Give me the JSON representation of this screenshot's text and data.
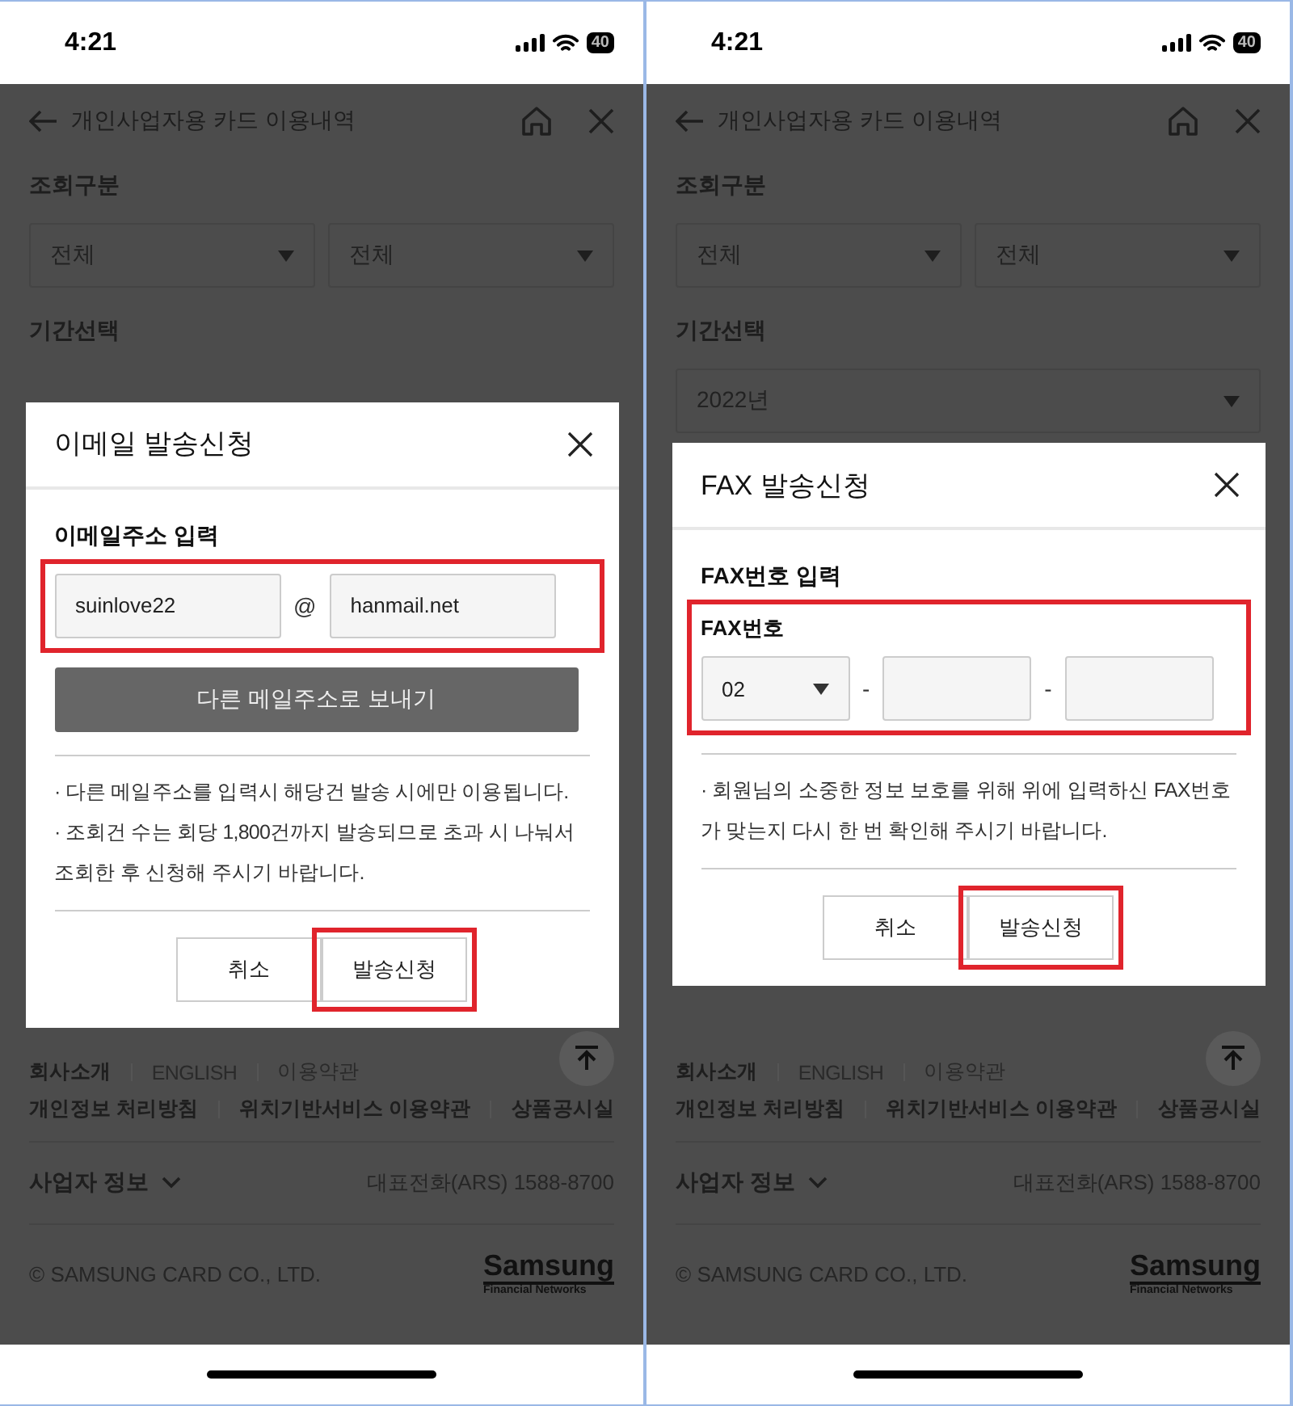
{
  "screens": [
    {
      "status_bar": {
        "time": "4:21",
        "battery": "40"
      },
      "header": {
        "title": "개인사업자용 카드 이용내역"
      },
      "form": [
        {
          "label": "조회구분",
          "selects": [
            {
              "value": "전체"
            },
            {
              "value": "전체"
            }
          ]
        },
        {
          "label": "기간선택"
        }
      ],
      "modal": {
        "title": "이메일 발송신청",
        "section_title": "이메일주소 입력",
        "field_group": {
          "highlighted": true,
          "separator": "@",
          "fields": [
            {
              "kind": "input",
              "value": "suinlove22"
            },
            {
              "kind": "input",
              "value": "hanmail.net"
            }
          ]
        },
        "wide_button": "다른 메일주소로 보내기",
        "notes": [
          "· 다른 메일주소를 입력시 해당건 발송 시에만 이용됩니다.",
          "· 조회건 수는 회당 1,800건까지 발송되므로 초과 시 나눠서 조회한 후 신청해 주시기 바랍니다."
        ],
        "buttons": [
          {
            "label": "취소",
            "highlighted": false
          },
          {
            "label": "발송신청",
            "highlighted": true
          }
        ]
      },
      "footer": {
        "links": [
          [
            {
              "label": "회사소개",
              "emphasis": true
            },
            {
              "label": "ENGLISH",
              "emphasis": false
            },
            {
              "label": "이용약관",
              "emphasis": false
            }
          ],
          [
            {
              "label": "개인정보 처리방침",
              "emphasis": true
            },
            {
              "label": "위치기반서비스 이용약관",
              "emphasis": true
            },
            {
              "label": "상품공시실",
              "emphasis": true
            }
          ]
        ],
        "business_info": "사업자 정보",
        "phone": "대표전화(ARS) 1588-8700",
        "copyright": "© SAMSUNG CARD CO., LTD.",
        "logo": {
          "name": "Samsung",
          "tagline": "Financial Networks"
        }
      }
    },
    {
      "status_bar": {
        "time": "4:21",
        "battery": "40"
      },
      "header": {
        "title": "개인사업자용 카드 이용내역"
      },
      "form": [
        {
          "label": "조회구분",
          "selects": [
            {
              "value": "전체"
            },
            {
              "value": "전체"
            }
          ]
        },
        {
          "label": "기간선택",
          "selects": [
            {
              "value": "2022년"
            }
          ]
        }
      ],
      "modal": {
        "title": "FAX 발송신청",
        "section_title": "FAX번호 입력",
        "field_group": {
          "highlighted": true,
          "label": "FAX번호",
          "separator": "-",
          "fields": [
            {
              "kind": "select",
              "value": "02"
            },
            {
              "kind": "input"
            },
            {
              "kind": "input"
            }
          ]
        },
        "notes": [
          "· 회원님의 소중한 정보 보호를 위해 위에 입력하신 FAX번호가 맞는지 다시 한 번 확인해 주시기 바랍니다."
        ],
        "buttons": [
          {
            "label": "취소",
            "highlighted": false
          },
          {
            "label": "발송신청",
            "highlighted": true
          }
        ]
      },
      "footer": {
        "links": [
          [
            {
              "label": "회사소개",
              "emphasis": true
            },
            {
              "label": "ENGLISH",
              "emphasis": false
            },
            {
              "label": "이용약관",
              "emphasis": false
            }
          ],
          [
            {
              "label": "개인정보 처리방침",
              "emphasis": true
            },
            {
              "label": "위치기반서비스 이용약관",
              "emphasis": true
            },
            {
              "label": "상품공시실",
              "emphasis": true
            }
          ]
        ],
        "business_info": "사업자 정보",
        "phone": "대표전화(ARS) 1588-8700",
        "copyright": "© SAMSUNG CARD CO., LTD.",
        "logo": {
          "name": "Samsung",
          "tagline": "Financial Networks"
        }
      }
    }
  ]
}
